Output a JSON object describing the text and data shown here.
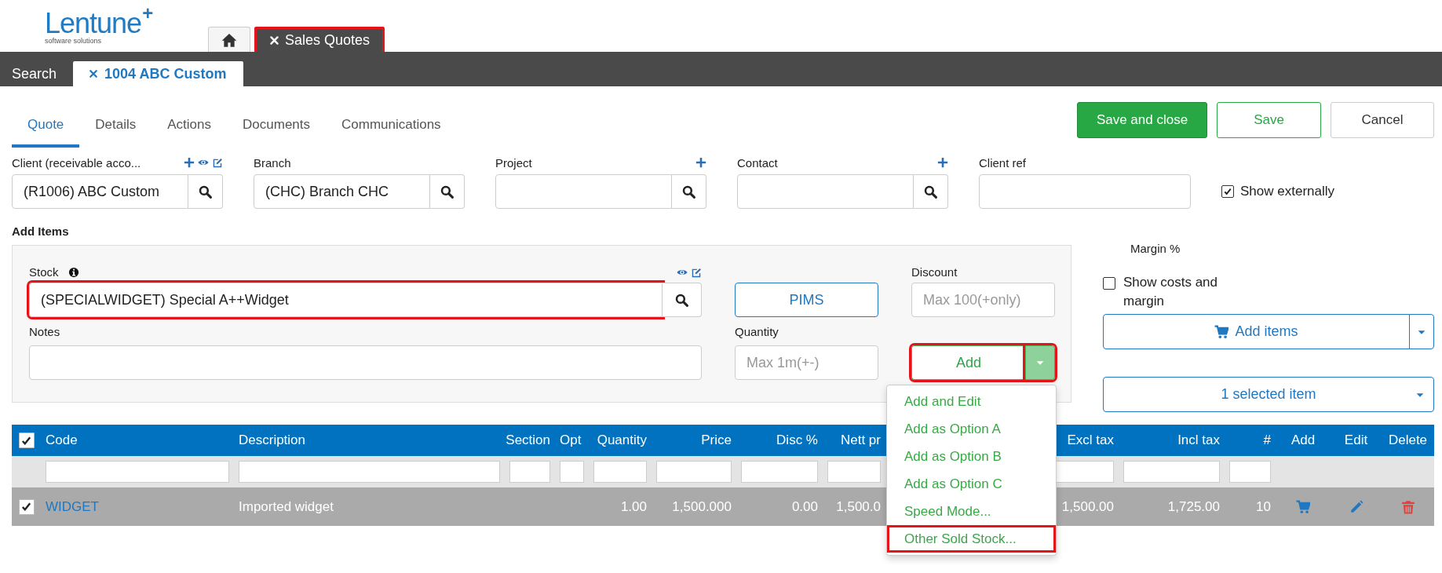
{
  "logo": {
    "name": "Lentune",
    "mark": "+",
    "tagline": "software solutions"
  },
  "outer_tabs": [
    {
      "kind": "home",
      "selected": false,
      "highlighted": false
    },
    {
      "kind": "page",
      "label": "Sales Quotes",
      "closable": true,
      "selected": true,
      "highlighted": true
    }
  ],
  "record_tabs": [
    {
      "label": "Search",
      "selected": false,
      "closable": false
    },
    {
      "label": "1004 ABC Custom",
      "selected": true,
      "closable": true
    }
  ],
  "section_tabs": [
    {
      "label": "Quote",
      "selected": true
    },
    {
      "label": "Details",
      "selected": false
    },
    {
      "label": "Actions",
      "selected": false
    },
    {
      "label": "Documents",
      "selected": false
    },
    {
      "label": "Communications",
      "selected": false
    }
  ],
  "actions": [
    {
      "label": "Save and close",
      "kind": "primary"
    },
    {
      "label": "Save",
      "kind": "outline"
    },
    {
      "label": "Cancel",
      "kind": "plain"
    }
  ],
  "fields": [
    {
      "kind": "lookup",
      "label": "Client (receivable acco...",
      "value": "(R1006) ABC Custom",
      "can_add": true,
      "can_view": true,
      "can_edit": true
    },
    {
      "kind": "lookup",
      "label": "Branch",
      "value": "(CHC) Branch CHC"
    },
    {
      "kind": "lookup",
      "label": "Project",
      "can_add": true
    },
    {
      "kind": "lookup",
      "label": "Contact",
      "can_add": true
    },
    {
      "kind": "text",
      "label": "Client ref"
    }
  ],
  "show_externally": {
    "label": "Show externally",
    "checked": true
  },
  "add_items": {
    "title": "Add Items",
    "stock": {
      "label": "Stock",
      "value": "(SPECIALWIDGET) Special A++Widget",
      "highlighted": true
    },
    "notes": {
      "label": "Notes"
    },
    "pims_button": "PIMS",
    "discount": {
      "label": "Discount",
      "placeholder": "Max 100(+only)"
    },
    "quantity": {
      "label": "Quantity",
      "placeholder": "Max 1m(+-)"
    },
    "add_button": {
      "label": "Add",
      "highlighted": true,
      "toggle_highlighted": true,
      "expanded": true
    },
    "menu": [
      {
        "label": "Add and Edit",
        "highlighted": false
      },
      {
        "label": "Add as Option A",
        "highlighted": false
      },
      {
        "label": "Add as Option B",
        "highlighted": false
      },
      {
        "label": "Add as Option C",
        "highlighted": false
      },
      {
        "label": "Speed Mode...",
        "highlighted": false
      },
      {
        "label": "Other Sold Stock...",
        "highlighted": true
      }
    ]
  },
  "side": {
    "margin_label": "Margin %",
    "show_costs": {
      "label": "Show costs and margin",
      "checked": false
    },
    "add_items_button": "Add items",
    "selection_button": "1 selected item"
  },
  "table": {
    "all_checked": true,
    "columns": [
      {
        "label": "Code",
        "kind": "link",
        "filter": true
      },
      {
        "label": "Description",
        "kind": "text",
        "filter": true
      },
      {
        "label": "Section",
        "kind": "number",
        "filter": true
      },
      {
        "label": "Opt",
        "kind": "text",
        "filter": true
      },
      {
        "label": "Quantity",
        "kind": "number",
        "filter": true
      },
      {
        "label": "Price",
        "kind": "number",
        "filter": true
      },
      {
        "label": "Disc %",
        "kind": "number",
        "filter": true
      },
      {
        "label": "Nett pr",
        "kind": "number",
        "filter": true
      },
      {
        "label": "Excl tax",
        "kind": "number",
        "filter": true
      },
      {
        "label": "Incl tax",
        "kind": "number",
        "filter": true
      },
      {
        "label": "#",
        "kind": "number",
        "filter": true
      },
      {
        "label": "Add",
        "kind": "cart"
      },
      {
        "label": "Edit",
        "kind": "edit"
      },
      {
        "label": "Delete",
        "kind": "delete"
      }
    ],
    "rows": [
      {
        "selected": true,
        "checked": true,
        "cells": [
          "WIDGET",
          "Imported widget",
          null,
          null,
          "1.00",
          "1,500.000",
          "0.00",
          "1,500.0",
          "1,500.00",
          "1,725.00",
          "10",
          null,
          null,
          null
        ]
      }
    ]
  }
}
